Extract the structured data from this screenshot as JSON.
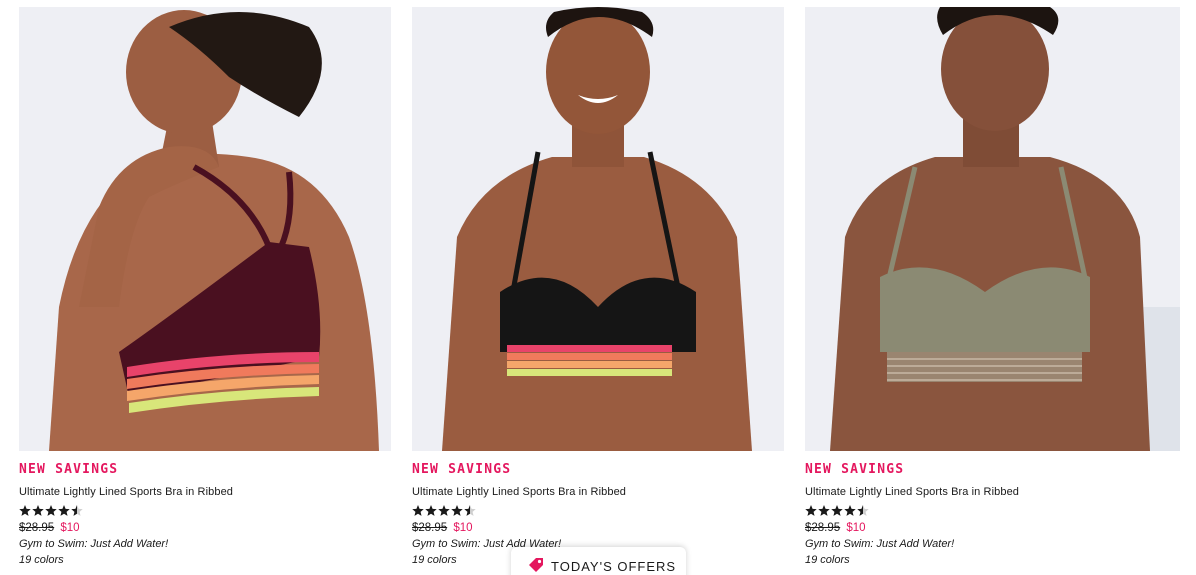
{
  "products": [
    {
      "badge": "NEW SAVINGS",
      "name": "Ultimate Lightly Lined Sports Bra in Ribbed",
      "rating": 4.5,
      "rating_max": 5,
      "price_original": "$28.95",
      "price_sale": "$10",
      "promo": "Gym to Swim: Just Add Water!",
      "colors": "19 colors",
      "bra_color": "#4a1020"
    },
    {
      "badge": "NEW SAVINGS",
      "name": "Ultimate Lightly Lined Sports Bra in Ribbed",
      "rating": 4.5,
      "rating_max": 5,
      "price_original": "$28.95",
      "price_sale": "$10",
      "promo": "Gym to Swim: Just Add Water!",
      "colors": "19 colors",
      "bra_color": "#151515"
    },
    {
      "badge": "NEW SAVINGS",
      "name": "Ultimate Lightly Lined Sports Bra in Ribbed",
      "rating": 4.5,
      "rating_max": 5,
      "price_original": "$28.95",
      "price_sale": "$10",
      "promo": "Gym to Swim: Just Add Water!",
      "colors": "19 colors",
      "bra_color": "#8b8a73"
    }
  ],
  "offers_tab": {
    "label": "TODAY'S OFFERS",
    "icon": "price-tag-icon"
  },
  "theme": {
    "accent": "#e4175e",
    "photo_bg": "#eeeff4"
  }
}
